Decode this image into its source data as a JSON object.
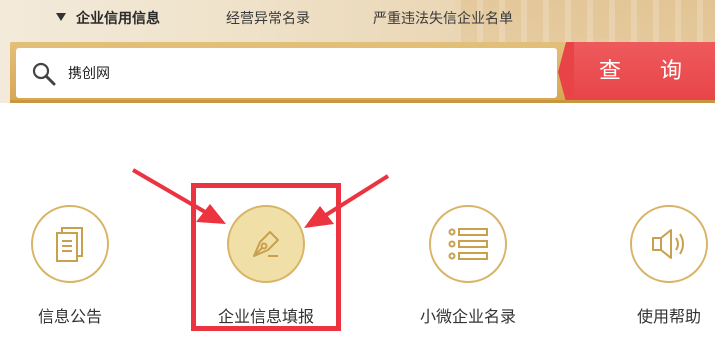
{
  "tabs": [
    {
      "label": "企业信用信息",
      "active": true
    },
    {
      "label": "经营异常名录",
      "active": false
    },
    {
      "label": "严重违法失信企业名单",
      "active": false
    }
  ],
  "search": {
    "value": "携创网",
    "button_label": "查 询"
  },
  "features": [
    {
      "label": "信息公告",
      "icon": "document-icon"
    },
    {
      "label": "企业信息填报",
      "icon": "pen-icon",
      "highlighted": true
    },
    {
      "label": "小微企业名录",
      "icon": "list-icon"
    },
    {
      "label": "使用帮助",
      "icon": "speaker-icon"
    }
  ],
  "colors": {
    "gold": "#d9b466",
    "gold_fill": "#f1dfa8",
    "search_button": "#e84447",
    "annotation_red": "#ec3440"
  }
}
